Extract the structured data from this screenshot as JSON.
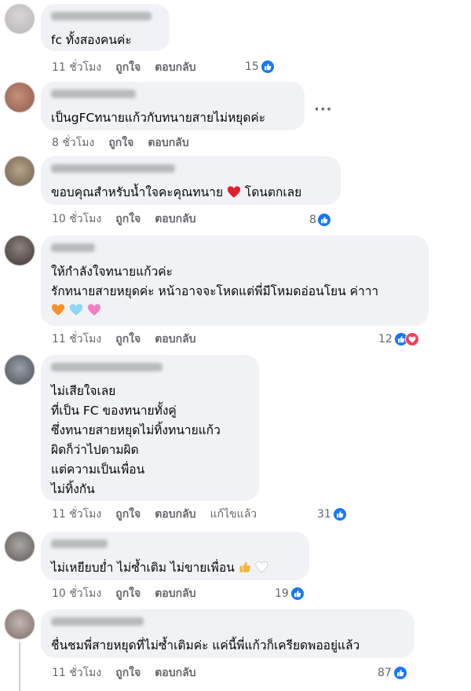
{
  "comments": [
    {
      "text": [
        "fc ทั้งสองคนค่ะ"
      ],
      "time": "11 ชั่วโมง",
      "like_label": "ถูกใจ",
      "reply_label": "ตอบกลับ",
      "reaction_count": "15",
      "reactions": [
        "like"
      ]
    },
    {
      "text": [
        "เป็นgFCทนายแก้วกับทนายสายไม่หยุดค่ะ"
      ],
      "time": "8 ชั่วโมง",
      "like_label": "ถูกใจ",
      "reply_label": "ตอบกลับ",
      "more_label": "···"
    },
    {
      "text": [
        "ขอบคุณสำหรับน้ำใจคะคุณทนาย",
        "โดนตกเลย"
      ],
      "time": "10 ชั่วโมง",
      "like_label": "ถูกใจ",
      "reply_label": "ตอบกลับ",
      "reaction_count": "8",
      "reactions": [
        "like"
      ],
      "emoji": [
        "red-heart"
      ]
    },
    {
      "text": [
        "ให้กำลังใจทนายแก้วค่ะ",
        "รักทนายสายหยุดค่ะ หน้าอาจจะโหดแต่พี่มีโหมดอ่อนโยน ค่าาา"
      ],
      "time": "11 ชั่วโมง",
      "like_label": "ถูกใจ",
      "reply_label": "ตอบกลับ",
      "reaction_count": "12",
      "reactions": [
        "like",
        "love"
      ],
      "emoji": [
        "orange-heart",
        "light-blue-heart",
        "pink-heart"
      ]
    },
    {
      "text": [
        "ไม่เสียใจเลย",
        "ที่เป็น FC ของทนายทั้งคู่",
        "ซึ่งทนายสายหยุดไม่ทิ้งทนายแก้ว",
        "ผิดก็ว่าไปตามผิด",
        "แต่ความเป็นเพื่อน",
        "ไม่ทิ้งกัน"
      ],
      "time": "11 ชั่วโมง",
      "like_label": "ถูกใจ",
      "reply_label": "ตอบกลับ",
      "edited_label": "แก้ไขแล้ว",
      "reaction_count": "31",
      "reactions": [
        "like"
      ]
    },
    {
      "text": [
        "ไม่เหยียบย่ำ ไม่ซ้ำเติม ไม่ขายเพื่อน"
      ],
      "time": "10 ชั่วโมง",
      "like_label": "ถูกใจ",
      "reply_label": "ตอบกลับ",
      "reaction_count": "19",
      "reactions": [
        "like"
      ],
      "emoji": [
        "thumbs-up",
        "white-heart"
      ]
    },
    {
      "text": [
        "ชื่นชมพี่สายหยุดที่ไม่ซ้ำเติมค่ะ แค่นี้พี่แก้วก็เครียดพออยู่แล้ว"
      ],
      "time": "11 ชั่วโมง",
      "like_label": "ถูกใจ",
      "reply_label": "ตอบกลับ",
      "reaction_count": "87",
      "reactions": [
        "like"
      ]
    }
  ],
  "colors": {
    "bubble": "#f0f2f5",
    "meta_text": "#65676b",
    "like_blue": "#1877f2",
    "love_red": "#f33e58"
  }
}
